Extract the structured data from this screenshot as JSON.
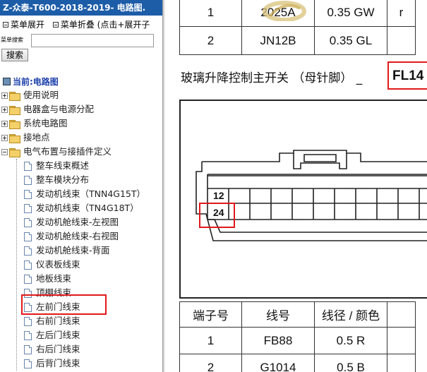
{
  "left": {
    "title": "Z-众泰-T600-2018-2019- 电路图.",
    "menu_expand": "菜单展开",
    "menu_collapse": "菜单折叠 (点击+展开子",
    "search_label": "菜单搜索",
    "search_value": "",
    "search_button": "搜索",
    "current": "当前:电路图",
    "tree_top": [
      {
        "label": "使用说明",
        "expanded": false
      },
      {
        "label": "电器盒与电源分配",
        "expanded": false
      },
      {
        "label": "系统电路图",
        "expanded": false
      },
      {
        "label": "接地点",
        "expanded": false
      },
      {
        "label": "电气布置与接插件定义",
        "expanded": true
      }
    ],
    "tree_children": [
      "整车线束概述",
      "整车模块分布",
      "发动机线束（TNN4G15T）",
      "发动机线束（TN4G18T）",
      "发动机舱线束-左视图",
      "发动机舱线束-右视图",
      "发动机舱线束-背面",
      "仪表板线束",
      "地板线束",
      "顶棚线束",
      "左前门线束",
      "右前门线束",
      "左后门线束",
      "右后门线束",
      "后背门线束"
    ],
    "selected": "左前门线束"
  },
  "right": {
    "top_table": [
      [
        "1",
        "2025A",
        "0.35 GW",
        "r"
      ],
      [
        "2",
        "JN12B",
        "0.35 GL",
        ""
      ]
    ],
    "section_title": "玻璃升降控制主开关 （母针脚） _",
    "connector_code": "FL14",
    "pin_12": "12",
    "pin_24": "24",
    "bottom_header": [
      "端子号",
      "线号",
      "线径 / 颜色",
      ""
    ],
    "bottom_rows": [
      [
        "1",
        "FB88",
        "0.5 R",
        ""
      ],
      [
        "2",
        "G1014",
        "0.5 B",
        ""
      ]
    ]
  }
}
